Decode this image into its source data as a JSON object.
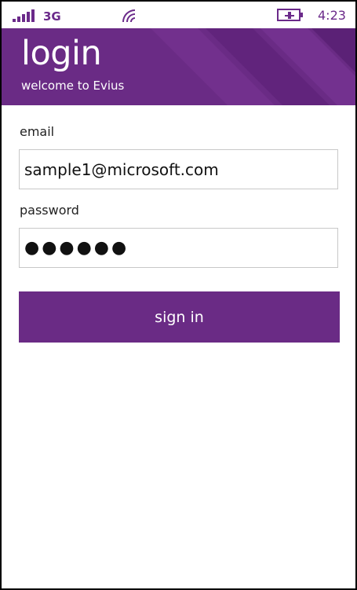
{
  "status_bar": {
    "network": "3G",
    "time": "4:23",
    "signal_icon": "signal-bars-icon",
    "wifi_icon": "wifi-icon",
    "battery_icon": "battery-charging-icon"
  },
  "header": {
    "title": "login",
    "subtitle": "welcome to Evius",
    "accent_color": "#6a2b85"
  },
  "form": {
    "email_label": "email",
    "email_value": "sample1@microsoft.com",
    "password_label": "password",
    "password_value": "●●●●●●",
    "signin_label": "sign in"
  }
}
